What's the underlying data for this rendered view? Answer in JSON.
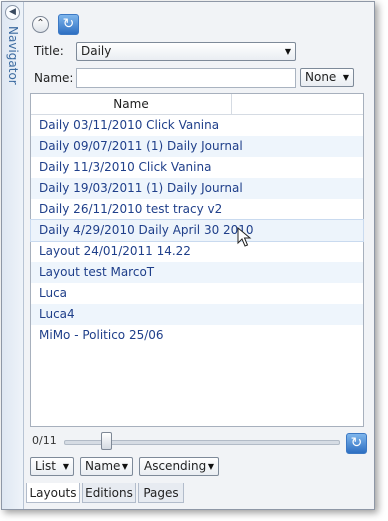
{
  "navigator": {
    "collapse_icon": "chevron-left-icon",
    "label": "Navigator"
  },
  "toolbar": {
    "collapse_icon": "chevron-up-icon",
    "refresh_icon": "refresh-icon"
  },
  "filters": {
    "title_label": "Title:",
    "title_value": "Daily",
    "name_label": "Name:",
    "name_value": "",
    "name_mode": "None"
  },
  "grid": {
    "column_header": "Name",
    "rows": [
      "Daily 03/11/2010 Click Vanina",
      "Daily 09/07/2011 (1) Daily Journal",
      "Daily 11/3/2010 Click Vanina",
      "Daily 19/03/2011 (1) Daily Journal",
      "Daily 26/11/2010 test tracy v2",
      "Daily 4/29/2010 Daily April 30 2010",
      "Layout 24/01/2011 14.22",
      "Layout test MarcoT",
      "Luca",
      "Luca4",
      "MiMo - Politico 25/06"
    ]
  },
  "pager": {
    "counter": "0/11",
    "slider_position_fraction": 0
  },
  "options": {
    "view": "List",
    "sort_field": "Name",
    "sort_order": "Ascending"
  },
  "tabs": [
    {
      "label": "Layouts",
      "active": true
    },
    {
      "label": "Editions",
      "active": false
    },
    {
      "label": "Pages",
      "active": false
    }
  ],
  "colors": {
    "row_text": "#1f3f8a",
    "accent": "#2e6fc2",
    "row_alt": "#eef5fc"
  }
}
